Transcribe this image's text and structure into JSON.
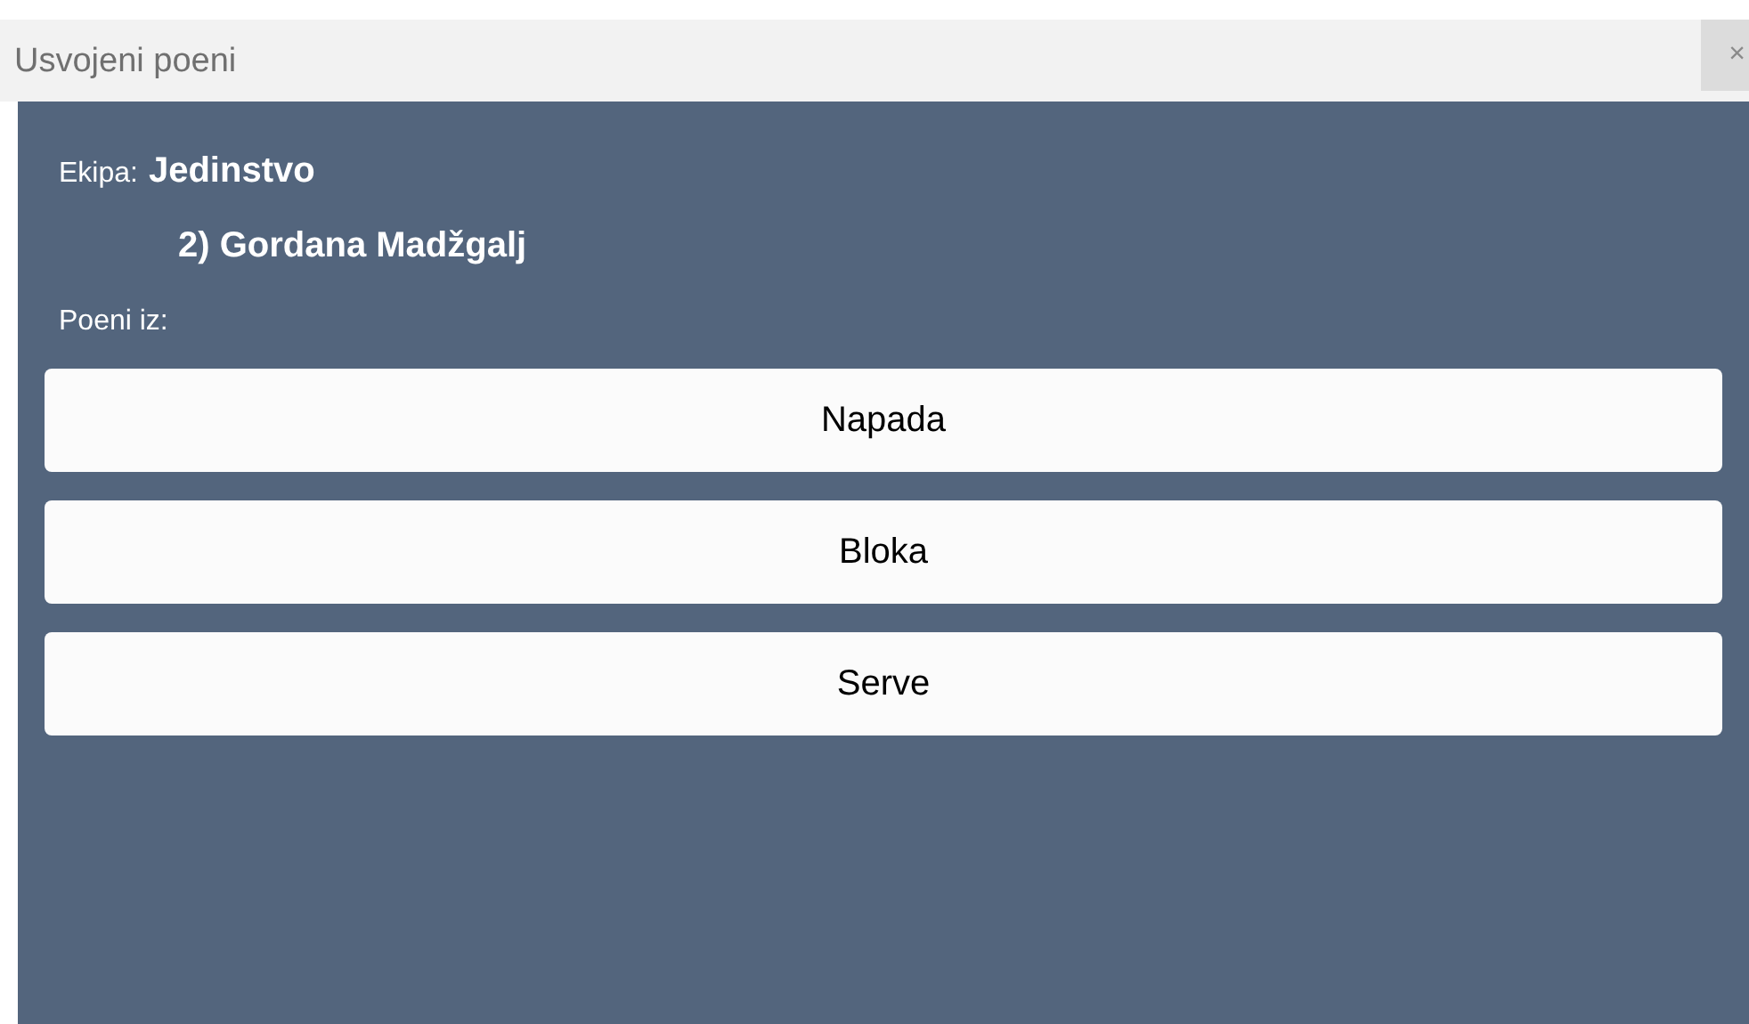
{
  "window": {
    "title": "Usvojeni poeni",
    "close": "×"
  },
  "team": {
    "label": "Ekipa:",
    "name": "Jedinstvo"
  },
  "player": "2) Gordana Madžgalj",
  "points_label": "Poeni iz:",
  "buttons": [
    "Napada",
    "Bloka",
    "Serve"
  ]
}
